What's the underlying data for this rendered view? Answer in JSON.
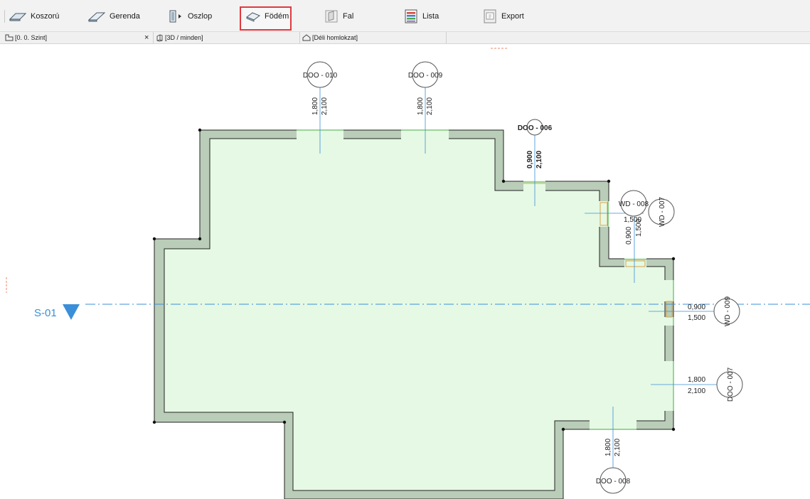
{
  "toolbar": {
    "buttons": [
      {
        "label": "Koszorú",
        "icon": "ring-beam-icon"
      },
      {
        "label": "Gerenda",
        "icon": "beam-icon"
      },
      {
        "label": "Oszlop",
        "icon": "column-icon"
      },
      {
        "label": "Födém",
        "icon": "slab-icon",
        "highlighted": true
      },
      {
        "label": "Fal",
        "icon": "wall-icon"
      },
      {
        "label": "Lista",
        "icon": "list-icon"
      },
      {
        "label": "Export",
        "icon": "export-icon"
      }
    ],
    "highlight_color": "#e0393e"
  },
  "tabs": [
    {
      "label": "[0. 0. Szint]",
      "icon": "floor-plan-icon"
    },
    {
      "label": "[3D / minden]",
      "icon": "3d-view-icon"
    },
    {
      "label": "[Déli homlokzat]",
      "icon": "elevation-icon"
    }
  ],
  "tab_close": "×",
  "plan": {
    "section_label": "S-01",
    "slab_color": "#e6f9e4",
    "wall_color": "#b9cdb8",
    "accent_color": "#3a8fd8",
    "openings": [
      {
        "tag": "DOO - 010",
        "dims": [
          "1,800",
          "2,100"
        ]
      },
      {
        "tag": "DOO - 009",
        "dims": [
          "1,800",
          "2,100"
        ]
      },
      {
        "tag": "DOO - 006",
        "dims": [
          "0,900",
          "2,100"
        ]
      },
      {
        "tag": "WD - 008",
        "dims": [
          "1,500",
          "0,900",
          "1,500"
        ]
      },
      {
        "tag": "WD - 007",
        "dims": []
      },
      {
        "tag": "WD - 009",
        "dims": [
          "0,900",
          "1,500"
        ]
      },
      {
        "tag": "DOO - 007",
        "dims": [
          "1,800",
          "2,100"
        ]
      },
      {
        "tag": "DOO - 008",
        "dims": [
          "1,800",
          "2,100"
        ]
      }
    ]
  }
}
